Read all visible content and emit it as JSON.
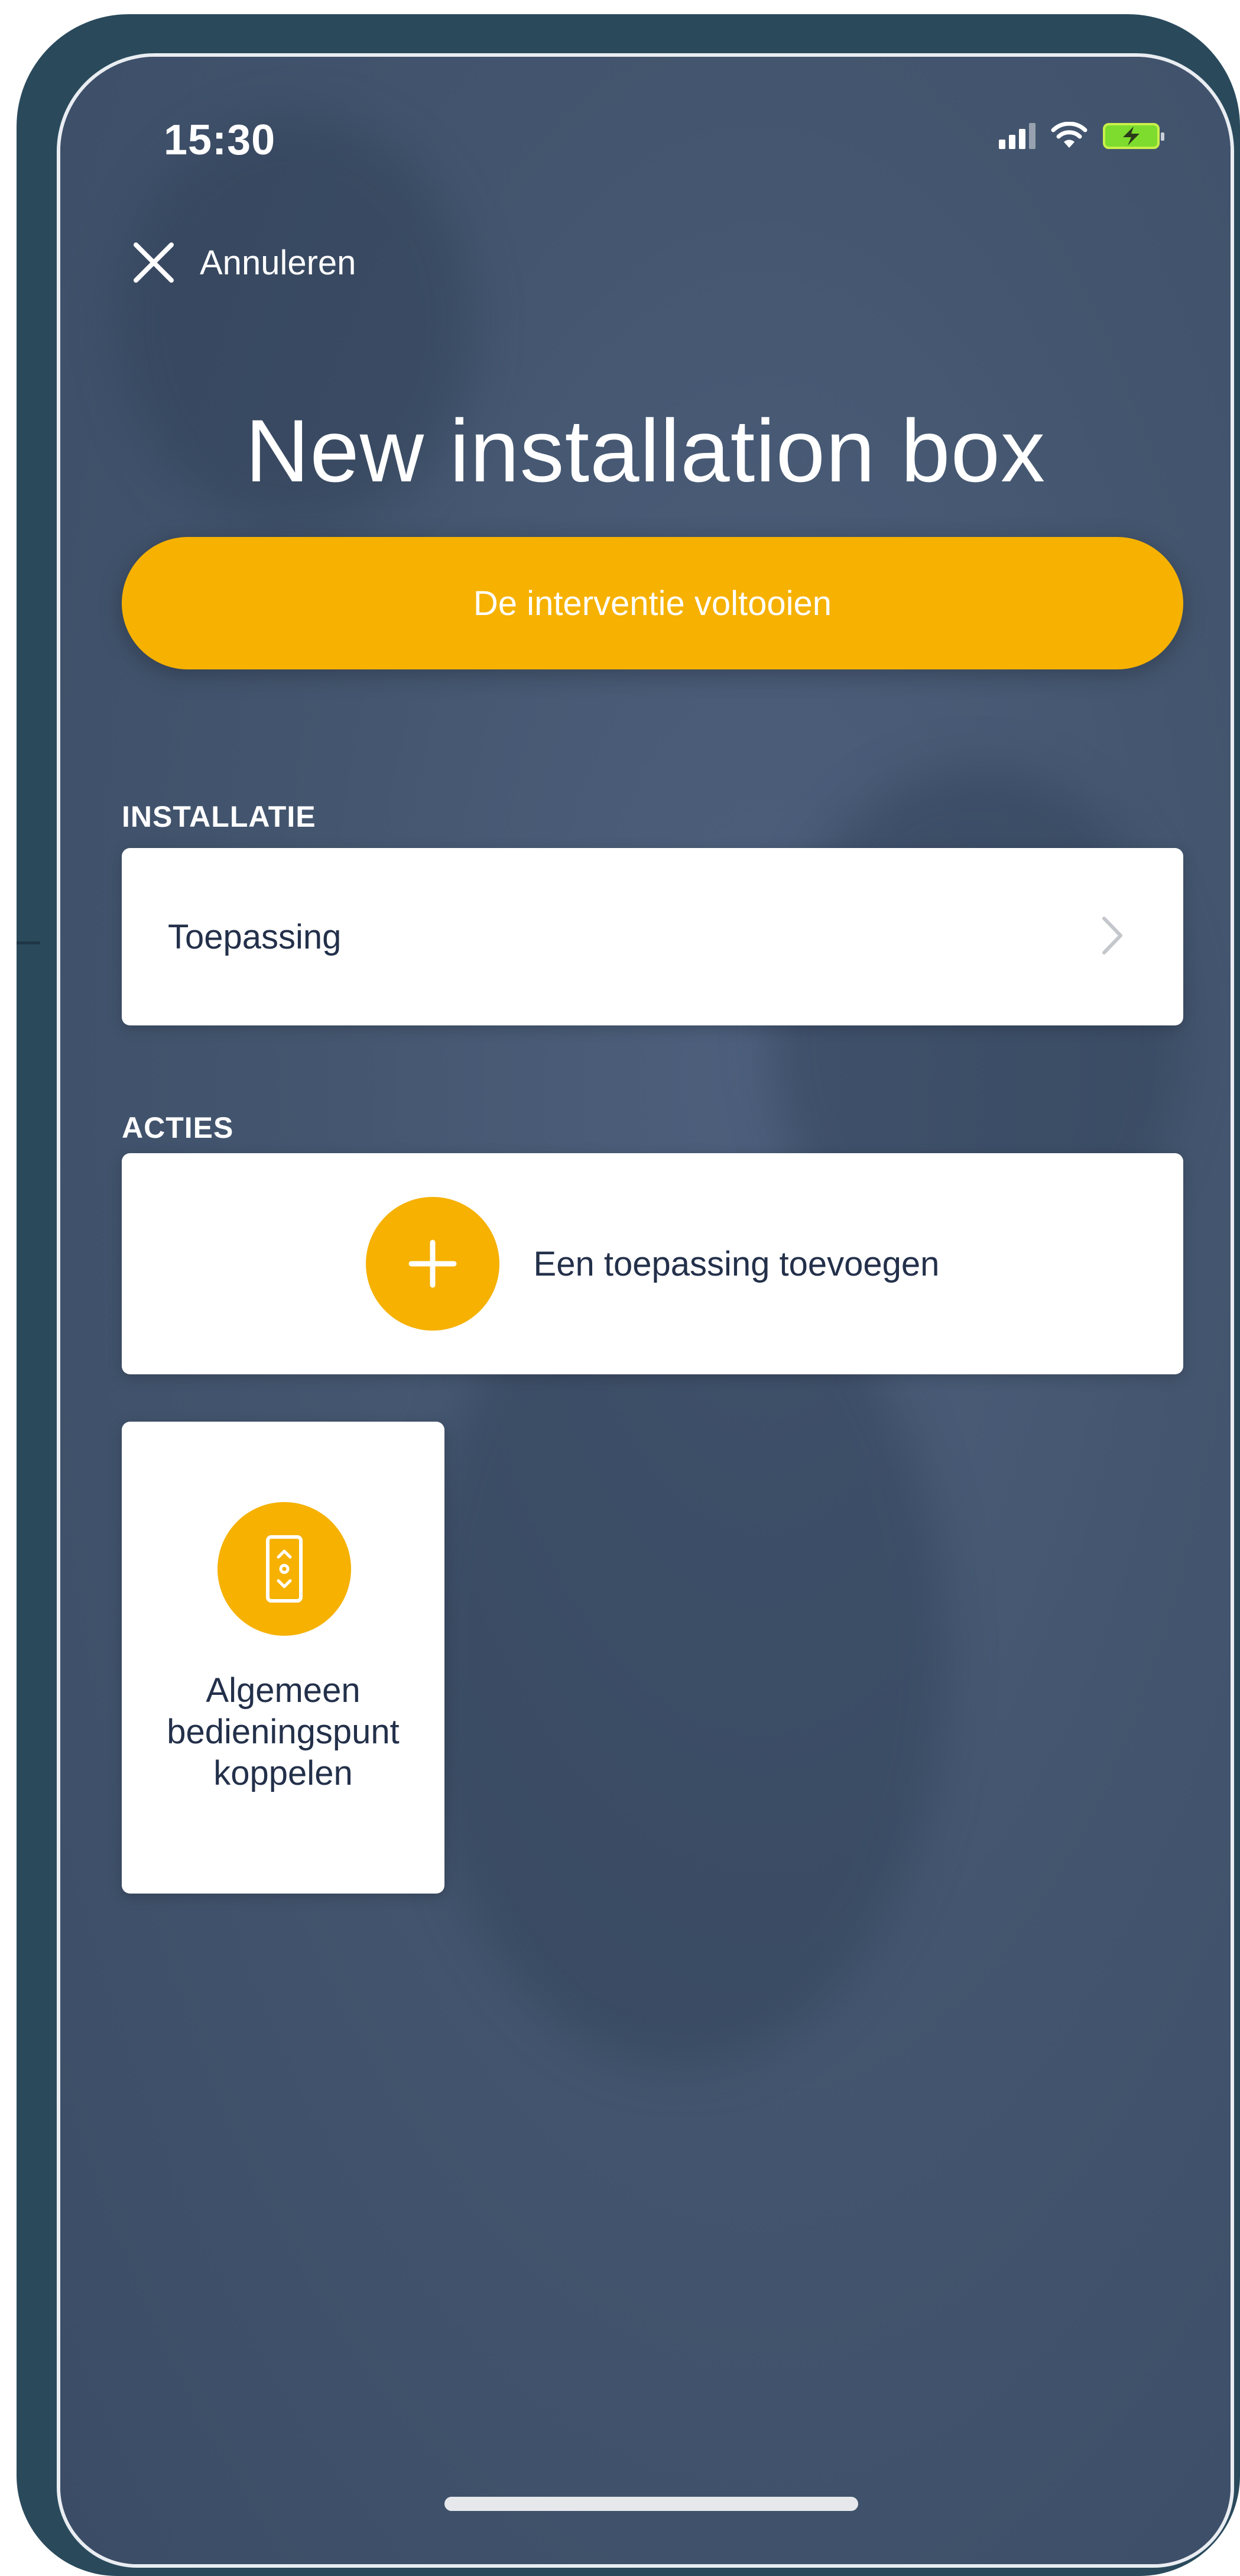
{
  "status_bar": {
    "time": "15:30"
  },
  "nav": {
    "cancel_label": "Annuleren"
  },
  "page": {
    "title": "New installation box"
  },
  "primary_action": {
    "label": "De interventie voltooien"
  },
  "sections": {
    "installation": {
      "label": "INSTALLATIE",
      "items": [
        {
          "label": "Toepassing"
        }
      ]
    },
    "actions": {
      "label": "ACTIES",
      "add_label": "Een toepassing toevoegen",
      "tiles": [
        {
          "label": "Algemeen\nbedieningspunt\nkoppelen"
        }
      ]
    }
  },
  "icons": {
    "close": "close-icon",
    "chevron": "chevron-right-icon",
    "plus": "plus-icon",
    "remote": "remote-control-icon",
    "signal": "signal-icon",
    "wifi": "wifi-icon",
    "battery": "battery-charging-icon"
  },
  "colors": {
    "accent": "#f6b101",
    "frame": "#2a4a5c",
    "text_dark": "#23304a",
    "chevron": "#c4c7cc",
    "battery": "#7ddc2d"
  }
}
